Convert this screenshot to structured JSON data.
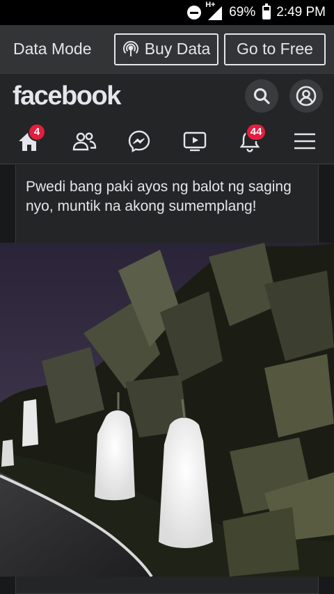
{
  "status_bar": {
    "network": "H+",
    "battery": "69%",
    "battery_level": 0.69,
    "time": "2:49 PM"
  },
  "data_mode": {
    "label": "Data Mode",
    "buy_data": "Buy Data",
    "go_free": "Go to Free"
  },
  "header": {
    "logo": "facebook",
    "search_icon": "search-icon",
    "profile_icon": "profile-icon"
  },
  "nav": {
    "home_badge": "4",
    "notifications_badge": "44",
    "icons": [
      "home-icon",
      "friends-icon",
      "messenger-icon",
      "watch-icon",
      "bell-icon",
      "menu-icon"
    ]
  },
  "post": {
    "text": "Pwedi bang paki ayos ng balot ng saging nyo, muntik na akong sumemplang!"
  },
  "colors": {
    "badge": "#e41e3f",
    "bar": "#333436",
    "background": "#242526"
  }
}
